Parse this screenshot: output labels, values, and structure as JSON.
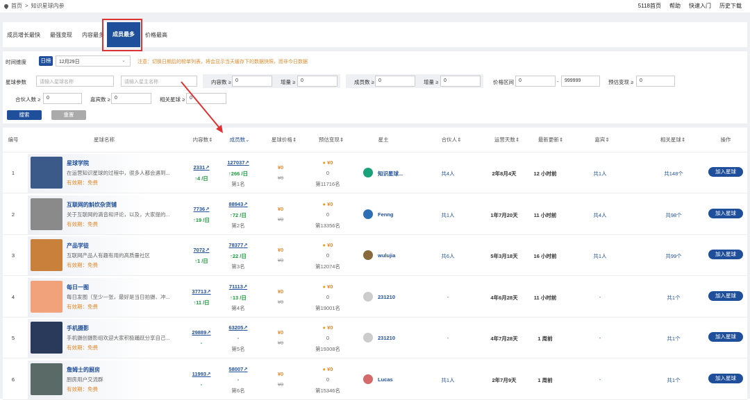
{
  "breadcrumb": {
    "home": "首页",
    "sep": ">",
    "current": "知识星球内参"
  },
  "toplinks": [
    "5118首页",
    "帮助",
    "快速入门",
    "历史下载"
  ],
  "tabs": [
    "成员增长最快",
    "最强变现",
    "内容最多",
    "成员最多",
    "价格最高"
  ],
  "filters": {
    "time_label": "时间维度",
    "day_button": "日榜",
    "date_value": "12月29日",
    "notice": "注意：切换日期后的榜单列表，将会显示当天缓存下的数据快照，而非今日数据",
    "params_label": "星球参数",
    "planet_placeholder": "请输入星球名称",
    "owner_placeholder": "请输入星主名称",
    "content_label": "内容数 ≥",
    "content_value": "0",
    "inc1_label": "增量 ≥",
    "inc1_value": "0",
    "members_label": "成员数 ≥",
    "members_value": "0",
    "inc2_label": "增量 ≥",
    "inc2_value": "0",
    "price_label": "价格区间",
    "price_min": "0",
    "price_dash": "-",
    "price_max": "999999",
    "est_label": "预估变现 ≥",
    "est_value": "0",
    "partner_label": "合伙人数 ≥",
    "partner_value": "0",
    "guest_label": "嘉宾数 ≥",
    "guest_value": "0",
    "related_label": "相关星球 ≥",
    "related_value": "0",
    "search_btn": "搜索",
    "reset_btn": "重置"
  },
  "headers": [
    "编号",
    "星球名称",
    "内容数",
    "成员数",
    "星球价格",
    "预估变现",
    "星主",
    "合伙人",
    "运营天数",
    "最新更新",
    "嘉宾",
    "相关星球",
    "操作"
  ],
  "rows": [
    {
      "no": "1",
      "name": "星球学院",
      "desc": "在运营知识星球的过程中，很多人都会遇到...",
      "valid": "有效期：免费",
      "content": "2331",
      "content_inc": "↑4 /日",
      "members": "127037",
      "members_inc": "↑266 /日",
      "rank": "第1名",
      "price": "¥0",
      "price_old": "¥0",
      "est": "¥0",
      "est_inc": "0",
      "est_rank": "第11716名",
      "owner": "知识星球...",
      "partner": "共4人",
      "days": "2年8月4天",
      "update": "12 小时前",
      "guest": "共1人",
      "related": "共148个",
      "join": "加入星球",
      "img_color": "#3b5a8a",
      "owner_color": "#1aa37a"
    },
    {
      "no": "2",
      "name": "互联网的斛炊杂货铺",
      "desc": "关于互联网的滴音和评论，以及，大家提的...",
      "valid": "有效期：免费",
      "content": "7736",
      "content_inc": "↑19 /日",
      "members": "88943",
      "members_inc": "↑72 /日",
      "rank": "第2名",
      "price": "¥0",
      "price_old": "¥0",
      "est": "¥0",
      "est_inc": "0",
      "est_rank": "第13356名",
      "owner": "Fenng",
      "partner": "共1人",
      "days": "1年7月20天",
      "update": "11 小时前",
      "guest": "共4人",
      "related": "共98个",
      "join": "加入星球",
      "img_color": "#8a8a8a",
      "owner_color": "#2d6fb5"
    },
    {
      "no": "3",
      "name": "产品学徒",
      "desc": "互联网产品人有趣有用的高质量社区",
      "valid": "有效期：免费",
      "content": "7072",
      "content_inc": "↑1 /日",
      "members": "78377",
      "members_inc": "↑22 /日",
      "rank": "第3名",
      "price": "¥0",
      "price_old": "¥0",
      "est": "¥0",
      "est_inc": "0",
      "est_rank": "第12074名",
      "owner": "wulujia",
      "partner": "共6人",
      "days": "5年3月18天",
      "update": "16 小时前",
      "guest": "共1人",
      "related": "共99个",
      "join": "加入星球",
      "img_color": "#c9803a",
      "owner_color": "#8a6a3a"
    },
    {
      "no": "4",
      "name": "每日一图",
      "desc": "每日发图（至少一张，最好是当日拍摄、冲...",
      "valid": "有效期：免费",
      "content": "37713",
      "content_inc": "↑11 /日",
      "members": "71113",
      "members_inc": "↑13 /日",
      "rank": "第4名",
      "price": "¥0",
      "price_old": "¥0",
      "est": "¥0",
      "est_inc": "0",
      "est_rank": "第19001名",
      "owner": "231210",
      "partner": "-",
      "days": "4年6月28天",
      "update": "11 小时前",
      "guest": "-",
      "related": "共1个",
      "join": "加入星球",
      "img_color": "#f2a27a",
      "owner_color": "#cccccc"
    },
    {
      "no": "5",
      "name": "手机摄影",
      "desc": "手机摄创摄影组欢迎大家积极踊跃分享自己...",
      "valid": "有效期：免费",
      "content": "29889",
      "content_inc": "-",
      "members": "63205",
      "members_inc": "-",
      "rank": "第5名",
      "price": "¥0",
      "price_old": "¥0",
      "est": "¥0",
      "est_inc": "0",
      "est_rank": "第19308名",
      "owner": "231210",
      "partner": "-",
      "days": "4年7月28天",
      "update": "1 周前",
      "guest": "-",
      "related": "共1个",
      "join": "加入星球",
      "img_color": "#2a3a5a",
      "owner_color": "#cccccc"
    },
    {
      "no": "6",
      "name": "詹姆士的厨房",
      "desc": "厨房用户交流群",
      "valid": "有效期：免费",
      "content": "11993",
      "content_inc": "-",
      "members": "58007",
      "members_inc": "-",
      "rank": "第6名",
      "price": "¥0",
      "price_old": "¥0",
      "est": "¥0",
      "est_inc": "0",
      "est_rank": "第15346名",
      "owner": "Lucas",
      "partner": "共1人",
      "days": "2年7月9天",
      "update": "1 周前",
      "guest": "-",
      "related": "共1个",
      "join": "加入星球",
      "img_color": "#5a6a66",
      "owner_color": "#d46a6a"
    }
  ]
}
